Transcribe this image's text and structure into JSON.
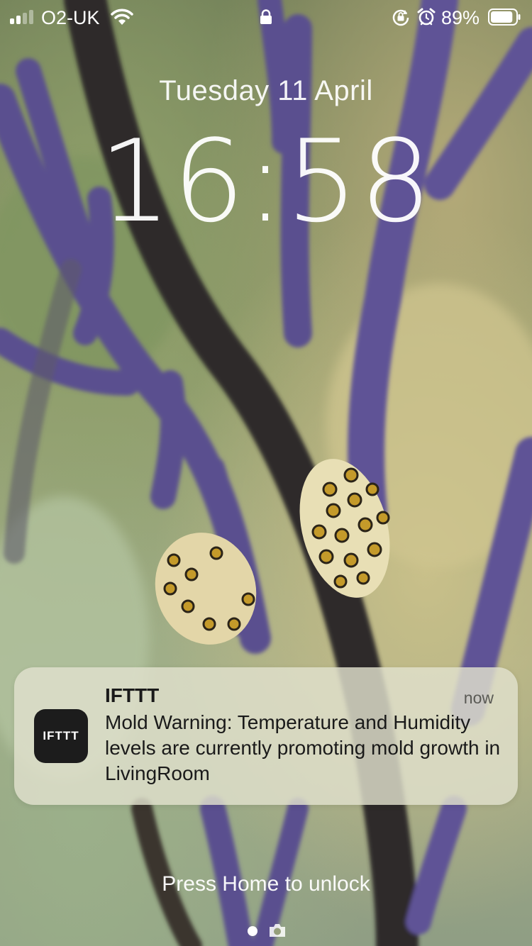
{
  "status_bar": {
    "carrier": "O2-UK",
    "battery_percent": "89%",
    "signal_bars_filled": 2,
    "signal_bars_total": 4,
    "battery_level": 0.89
  },
  "lock_screen": {
    "date": "Tuesday 11 April",
    "time": "16:58",
    "unlock_hint": "Press Home to unlock"
  },
  "notification": {
    "app_icon_text": "IFTTT",
    "app_name": "IFTTT",
    "time": "now",
    "body": "Mold Warning: Temperature and Humidity levels are currently promoting mold growth in LivingRoom"
  },
  "icons": [
    "signal-icon",
    "wifi-icon",
    "lock-icon",
    "rotation-lock-icon",
    "alarm-icon",
    "battery-icon",
    "camera-icon"
  ],
  "colors": {
    "notification_bg": "#e1e1cd",
    "app_icon_bg": "#1c1c1c",
    "coral_purple": "#5b4f91"
  }
}
